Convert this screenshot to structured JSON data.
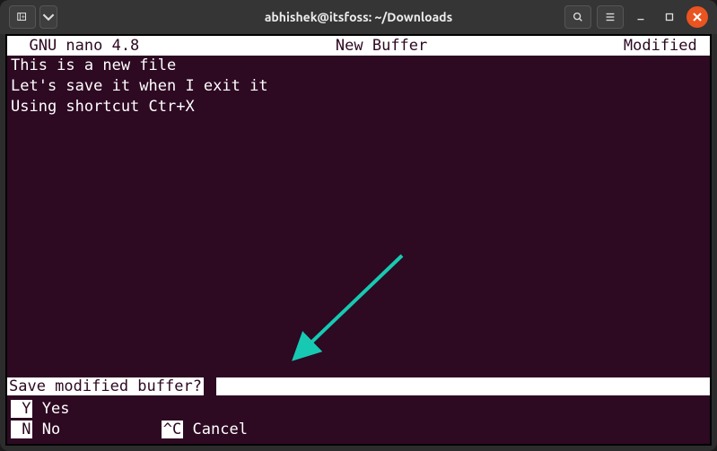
{
  "window": {
    "title": "abhishek@itsfoss: ~/Downloads"
  },
  "nano": {
    "app_name": "  GNU nano 4.8",
    "buffer_name": "New Buffer",
    "status": "Modified ",
    "content_line1": "This is a new file",
    "content_line2": "Let's save it when I exit it",
    "content_line3": "Using shortcut Ctr+X",
    "prompt": "Save modified buffer?",
    "shortcut_y_key": " Y",
    "shortcut_y_label": " Yes",
    "shortcut_n_key": " N",
    "shortcut_n_label": " No",
    "shortcut_c_key": "^C",
    "shortcut_c_label": " Cancel"
  }
}
